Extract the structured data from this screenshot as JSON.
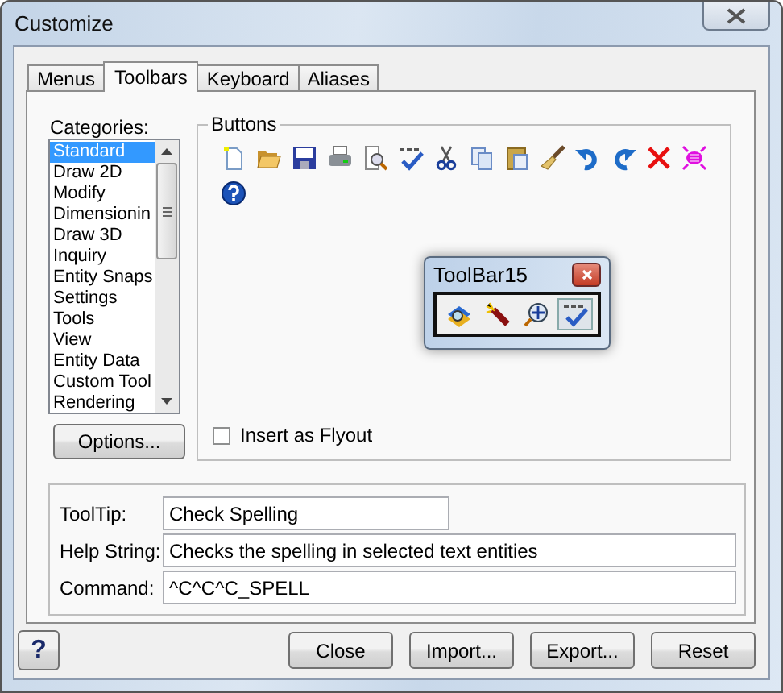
{
  "window": {
    "title": "Customize"
  },
  "tabs": [
    {
      "label": "Menus",
      "selected": false
    },
    {
      "label": "Toolbars",
      "selected": true
    },
    {
      "label": "Keyboard",
      "selected": false
    },
    {
      "label": "Aliases",
      "selected": false
    }
  ],
  "categories": {
    "label": "Categories:",
    "items": [
      {
        "label": "Standard",
        "selected": true
      },
      {
        "label": "Draw 2D",
        "selected": false
      },
      {
        "label": "Modify",
        "selected": false
      },
      {
        "label": "Dimensionin",
        "selected": false
      },
      {
        "label": "Draw 3D",
        "selected": false
      },
      {
        "label": "Inquiry",
        "selected": false
      },
      {
        "label": "Entity Snaps",
        "selected": false
      },
      {
        "label": "Settings",
        "selected": false
      },
      {
        "label": "Tools",
        "selected": false
      },
      {
        "label": "View",
        "selected": false
      },
      {
        "label": "Entity Data",
        "selected": false
      },
      {
        "label": "Custom Tool",
        "selected": false
      },
      {
        "label": "Rendering",
        "selected": false
      }
    ]
  },
  "options_button": "Options...",
  "buttons_group": {
    "title": "Buttons",
    "insert_as_flyout": {
      "label": "Insert as Flyout",
      "checked": false
    }
  },
  "toolbar15": {
    "title": "ToolBar15",
    "buttons": [
      {
        "selected": false
      },
      {
        "selected": false
      },
      {
        "selected": false
      },
      {
        "selected": true
      }
    ]
  },
  "fields": [
    {
      "label": "ToolTip:",
      "value": "Check Spelling",
      "kind": "short"
    },
    {
      "label": "Help String:",
      "value": "Checks the spelling in selected text entities",
      "kind": "long"
    },
    {
      "label": "Command:",
      "value": "^C^C^C_SPELL",
      "kind": "long"
    }
  ],
  "help_button": "?",
  "footer_buttons": [
    "Close",
    "Import...",
    "Export...",
    "Reset"
  ]
}
